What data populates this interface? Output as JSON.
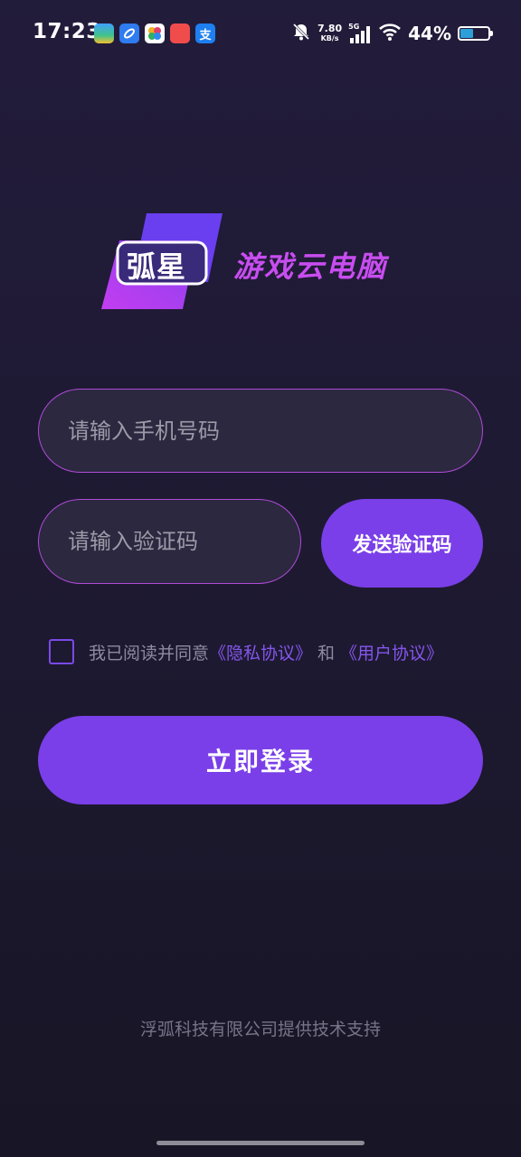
{
  "status_bar": {
    "time": "17:23",
    "net_speed_value": "7.80",
    "net_speed_unit": "KB/s",
    "network_type": "5G",
    "battery_percent": "44%",
    "battery_level": 0.44,
    "app_icons": [
      "weather-app-icon",
      "browser-app-icon",
      "gallery-app-icon",
      "huawei-app-icon",
      "alipay-app-icon"
    ],
    "alipay_glyph": "支"
  },
  "logo": {
    "badge_text": "弧星",
    "title": "游戏云电脑"
  },
  "phone_input": {
    "placeholder": "请输入手机号码",
    "value": ""
  },
  "code_input": {
    "placeholder": "请输入验证码",
    "value": ""
  },
  "send_code_label": "发送验证码",
  "agreement": {
    "checked": false,
    "prefix": "我已阅读并同意",
    "privacy_link": "《隐私协议》",
    "and": "和",
    "user_link": "《用户协议》"
  },
  "login_label": "立即登录",
  "footer": "浮弧科技有限公司提供技术支持",
  "colors": {
    "accent": "#7a3fe8",
    "logo_pink": "#c84df0",
    "input_border": "#b04ad8",
    "background": "#1d1930"
  }
}
